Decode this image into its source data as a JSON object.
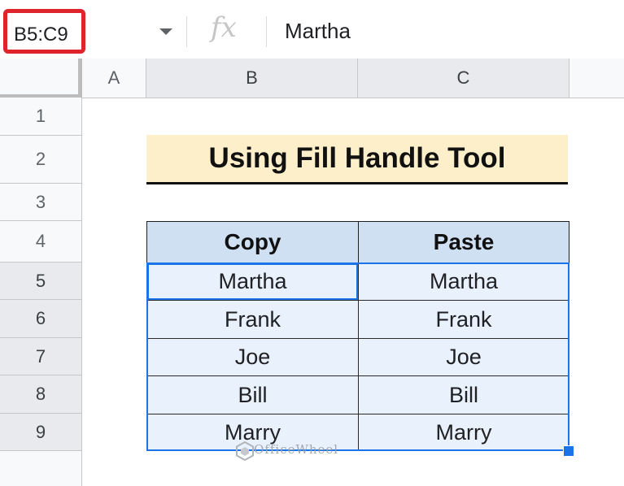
{
  "formula_bar": {
    "name_box": "B5:C9",
    "fx_symbol": "fx",
    "formula_value": "Martha"
  },
  "columns": [
    "A",
    "B",
    "C"
  ],
  "rows": [
    "1",
    "2",
    "3",
    "4",
    "5",
    "6",
    "7",
    "8",
    "9"
  ],
  "title": "Using Fill Handle Tool",
  "table": {
    "headers": [
      "Copy",
      "Paste"
    ],
    "rows": [
      [
        "Martha",
        "Martha"
      ],
      [
        "Frank",
        "Frank"
      ],
      [
        "Joe",
        "Joe"
      ],
      [
        "Bill",
        "Bill"
      ],
      [
        "Marry",
        "Marry"
      ]
    ]
  },
  "watermark": "OfficeWheel",
  "colors": {
    "selection": "#1a73e8",
    "name_box_highlight": "#e0242b",
    "title_bg": "#fdefc9",
    "header_bg": "#cfe0f2",
    "data_bg": "#e9f1fc"
  }
}
